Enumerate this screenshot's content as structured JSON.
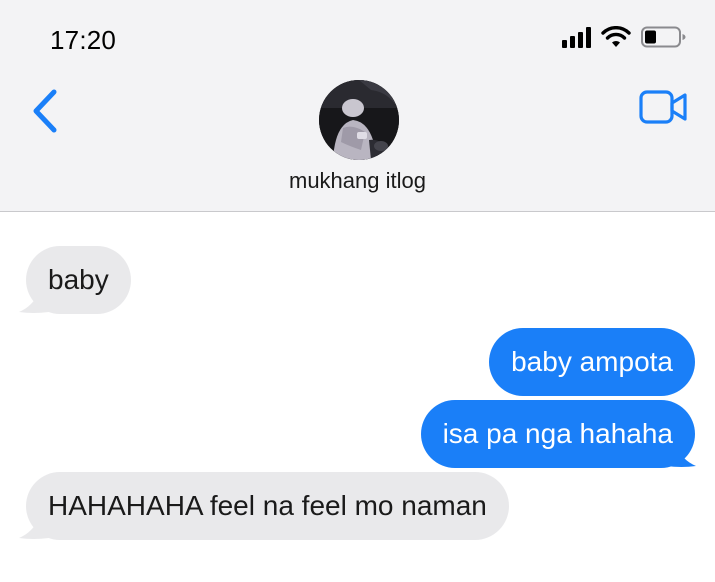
{
  "status_bar": {
    "time": "17:20"
  },
  "header": {
    "contact_name": "mukhang itlog",
    "back_icon": "chevron-left-icon",
    "video_icon": "video-camera-icon",
    "accent_color": "#1a7ff8"
  },
  "messages": [
    {
      "direction": "incoming",
      "text": "baby"
    },
    {
      "direction": "outgoing",
      "text": "baby ampota"
    },
    {
      "direction": "outgoing",
      "text": "isa pa nga hahaha"
    },
    {
      "direction": "incoming",
      "text": "HAHAHAHA feel na feel mo naman"
    }
  ],
  "colors": {
    "incoming_bubble": "#e9e9eb",
    "outgoing_bubble": "#1a7ff8",
    "header_bg": "#f3f3f5"
  }
}
